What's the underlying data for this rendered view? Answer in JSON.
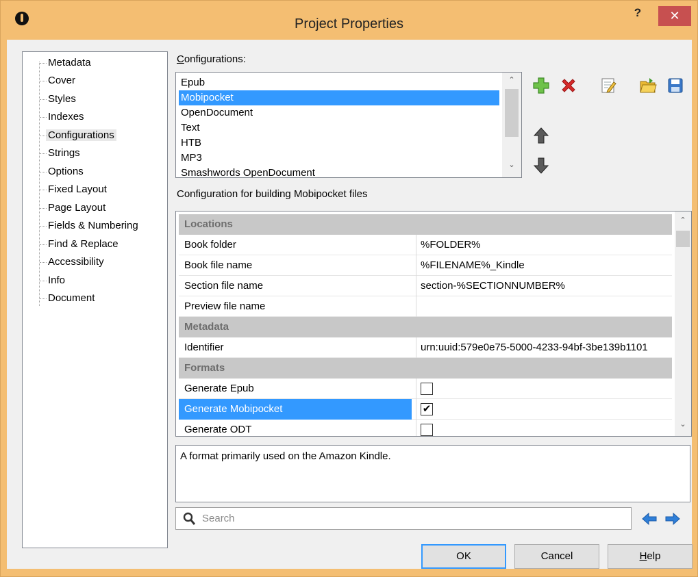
{
  "window": {
    "title": "Project Properties",
    "help_label": "?",
    "close_label": "✕"
  },
  "tree": {
    "items": [
      {
        "label": "Metadata"
      },
      {
        "label": "Cover"
      },
      {
        "label": "Styles"
      },
      {
        "label": "Indexes"
      },
      {
        "label": "Configurations",
        "selected": true
      },
      {
        "label": "Strings"
      },
      {
        "label": "Options"
      },
      {
        "label": "Fixed Layout"
      },
      {
        "label": "Page Layout"
      },
      {
        "label": "Fields & Numbering"
      },
      {
        "label": "Find & Replace"
      },
      {
        "label": "Accessibility"
      },
      {
        "label": "Info"
      },
      {
        "label": "Document"
      }
    ]
  },
  "configurations": {
    "label_underlined": "C",
    "label_rest": "onfigurations:",
    "items": [
      "Epub",
      "Mobipocket",
      "OpenDocument",
      "Text",
      "HTB",
      "MP3",
      "Smashwords OpenDocument"
    ],
    "selected": "Mobipocket",
    "description_heading": "Configuration for building Mobipocket files"
  },
  "toolbar": {
    "add_icon": "add-plus-icon",
    "delete_icon": "delete-x-icon",
    "edit_icon": "edit-icon",
    "open_icon": "open-folder-icon",
    "save_icon": "save-disk-icon",
    "up_icon": "move-up-icon",
    "down_icon": "move-down-icon"
  },
  "grid": {
    "categories": {
      "locations": "Locations",
      "metadata": "Metadata",
      "formats": "Formats"
    },
    "rows": {
      "book_folder": {
        "name": "Book folder",
        "value": "%FOLDER%"
      },
      "book_file_name": {
        "name": "Book file name",
        "value": "%FILENAME%_Kindle"
      },
      "section_file_name": {
        "name": "Section file name",
        "value": "section-%SECTIONNUMBER%"
      },
      "preview_file_name": {
        "name": "Preview file name",
        "value": ""
      },
      "identifier": {
        "name": "Identifier",
        "value": "urn:uuid:579e0e75-5000-4233-94bf-3be139b1101"
      },
      "generate_epub": {
        "name": "Generate Epub",
        "checked": false
      },
      "generate_mobipocket": {
        "name": "Generate Mobipocket",
        "checked": true,
        "check_mark": "✔"
      },
      "generate_odt": {
        "name": "Generate ODT",
        "checked": false
      }
    }
  },
  "description": "A format primarily used on the Amazon Kindle.",
  "search": {
    "placeholder": "Search",
    "value": ""
  },
  "buttons": {
    "ok": "OK",
    "cancel": "Cancel",
    "help_underlined": "H",
    "help_rest": "elp"
  },
  "colors": {
    "title_bar": "#f4be72",
    "close_button": "#c75050",
    "selection": "#3399ff",
    "category_row": "#c8c8c8"
  }
}
